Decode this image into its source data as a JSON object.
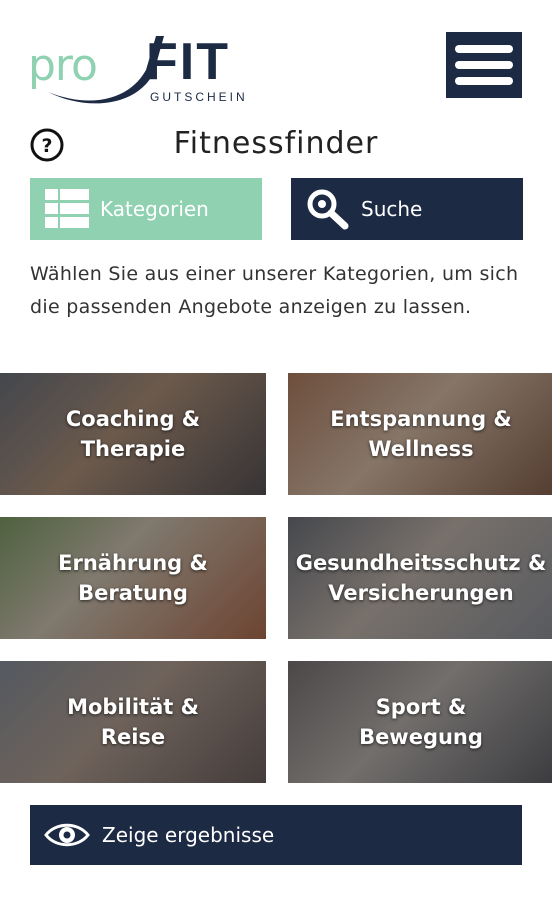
{
  "brand": {
    "logo_pro": "pro",
    "logo_fit": "FIT",
    "logo_sub": "GUTSCHEIN",
    "accent_green": "#8fd1b0",
    "navy": "#1c2a44"
  },
  "header": {
    "menu_icon": "hamburger-menu-icon"
  },
  "page": {
    "title": "Fitnessfinder",
    "help_icon": "question-circle-icon"
  },
  "tabs": [
    {
      "label": "Kategorien",
      "icon": "grid-icon",
      "active": true
    },
    {
      "label": "Suche",
      "icon": "magnifier-icon",
      "active": false
    }
  ],
  "description": "Wählen Sie aus einer unserer Kategorien, um sich die passenden Angebote anzeigen zu lassen.",
  "categories": [
    {
      "line1": "Coaching &",
      "line2": "Therapie"
    },
    {
      "line1": "Entspannung &",
      "line2": "Wellness"
    },
    {
      "line1": "Ernährung &",
      "line2": "Beratung"
    },
    {
      "line1": "Gesundheitsschutz &",
      "line2": "Versicherungen"
    },
    {
      "line1": "Mobilität &",
      "line2": "Reise"
    },
    {
      "line1": "Sport &",
      "line2": "Bewegung"
    }
  ],
  "results_button": {
    "label": "Zeige ergebnisse",
    "icon": "eye-icon"
  }
}
